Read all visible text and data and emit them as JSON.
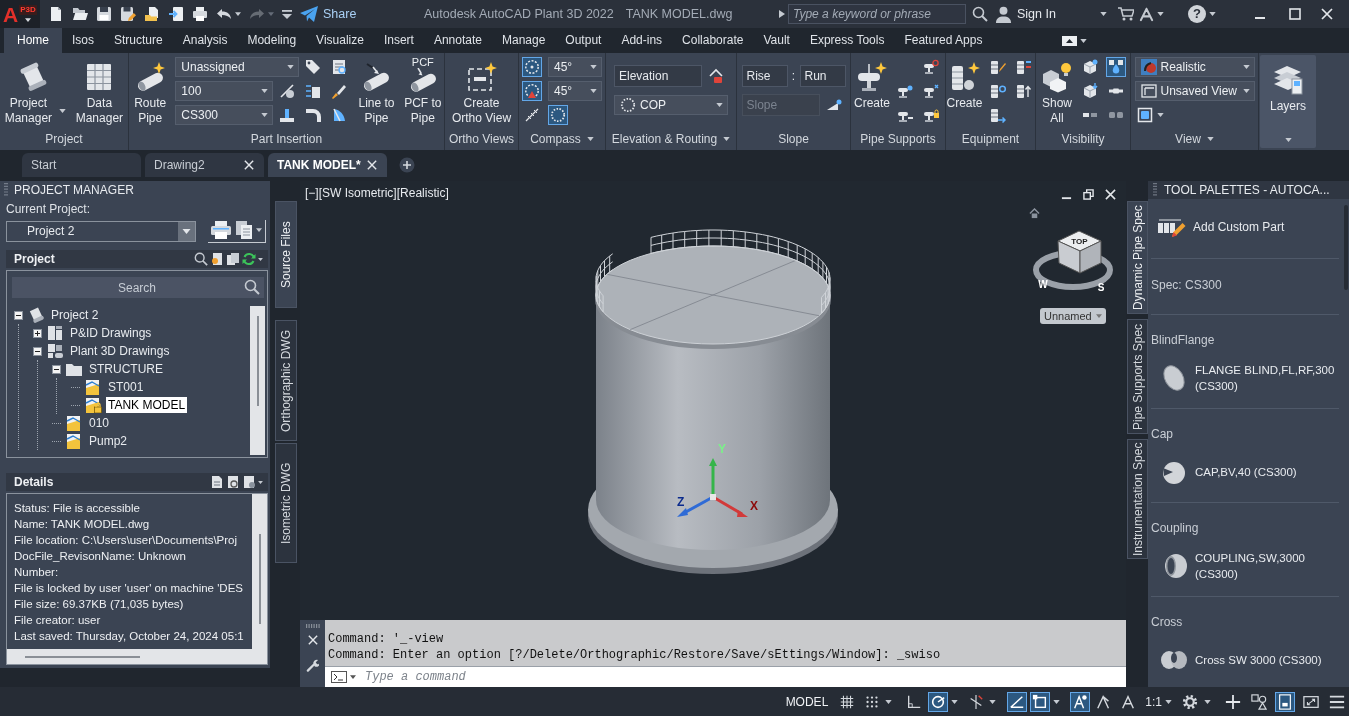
{
  "app_button": {
    "letter": "A",
    "product": "P3D"
  },
  "quick_access": {
    "tools": [
      {
        "disabled": false
      },
      {
        "disabled": false
      },
      {
        "disabled": false
      },
      {
        "disabled": false
      },
      {
        "disabled": false
      },
      {
        "disabled": false
      },
      {
        "disabled": false
      },
      {
        "disabled": false
      },
      {
        "disabled": true
      }
    ],
    "share": "Share"
  },
  "window": {
    "title": "Autodesk AutoCAD Plant 3D 2022",
    "document": "TANK MODEL.dwg"
  },
  "search": {
    "placeholder": "Type a keyword or phrase"
  },
  "account": {
    "label": "Sign In"
  },
  "help": {
    "label": "?"
  },
  "ribbon": {
    "tabs": [
      {
        "label": "Home",
        "selected": true
      },
      {
        "label": "Isos",
        "selected": false
      },
      {
        "label": "Structure",
        "selected": false
      },
      {
        "label": "Analysis",
        "selected": false
      },
      {
        "label": "Modeling",
        "selected": false
      },
      {
        "label": "Visualize",
        "selected": false
      },
      {
        "label": "Insert",
        "selected": false
      },
      {
        "label": "Annotate",
        "selected": false
      },
      {
        "label": "Manage",
        "selected": false
      },
      {
        "label": "Output",
        "selected": false
      },
      {
        "label": "Add-ins",
        "selected": false
      },
      {
        "label": "Collaborate",
        "selected": false
      },
      {
        "label": "Vault",
        "selected": false
      },
      {
        "label": "Express Tools",
        "selected": false
      },
      {
        "label": "Featured Apps",
        "selected": false
      }
    ],
    "panels": [
      {
        "kind": "panel",
        "title": "Project",
        "menu": false,
        "groups": [
          {
            "kind": "large",
            "label": "Project Manager",
            "menu": true
          },
          {
            "kind": "large",
            "label": "Data Manager",
            "menu": false
          }
        ]
      },
      {
        "kind": "panel",
        "title": "Part Insertion",
        "menu": false,
        "groups": [
          {
            "kind": "large",
            "label": "Route Pipe",
            "menu": false
          },
          {
            "kind": "grid",
            "items": [
              {
                "kind": "combo",
                "value": "Unassigned"
              },
              {
                "kind": "tool",
                "on": false
              },
              {
                "kind": "tool",
                "on": false
              },
              {
                "kind": "combo",
                "value": "100"
              },
              {
                "kind": "tool",
                "on": false
              },
              {
                "kind": "tool",
                "on": false
              },
              {
                "kind": "tool",
                "on": false
              },
              {
                "kind": "combo",
                "value": "CS300"
              },
              {
                "kind": "tool",
                "on": false
              },
              {
                "kind": "tool",
                "on": false
              },
              {
                "kind": "tool",
                "on": false
              }
            ]
          },
          {
            "kind": "large",
            "label": "Line to Pipe",
            "menu": false
          },
          {
            "kind": "large",
            "label": "PCF to Pipe",
            "icon_text": "PCF",
            "menu": false
          }
        ]
      },
      {
        "kind": "panel",
        "title": "Ortho Views",
        "menu": false,
        "groups": [
          {
            "kind": "large",
            "label": "Create Ortho View",
            "menu": false
          }
        ]
      },
      {
        "kind": "panel",
        "title": "Compass",
        "menu": true,
        "groups": [
          {
            "kind": "grid",
            "items": [
              {
                "kind": "tool",
                "on": true
              },
              {
                "kind": "combo",
                "value": "45°"
              },
              {
                "kind": "tool",
                "on": true
              },
              {
                "kind": "combo",
                "value": "45°"
              },
              {
                "kind": "tool",
                "on": false
              },
              {
                "kind": "tool",
                "on": true
              }
            ]
          }
        ]
      },
      {
        "kind": "panel",
        "title": "Elevation & Routing",
        "menu": true,
        "groups": [
          {
            "kind": "grid",
            "items": [
              {
                "kind": "field",
                "placeholder": "Elevation",
                "disabled": false
              },
              {
                "kind": "tool",
                "on": false
              },
              {
                "kind": "combo",
                "value": "COP"
              }
            ]
          }
        ]
      },
      {
        "kind": "panel",
        "title": "Slope",
        "menu": false,
        "groups": [
          {
            "kind": "grid",
            "items": [
              {
                "kind": "field",
                "placeholder": "Rise",
                "disabled": false
              },
              {
                "kind": "text",
                "label": ":"
              },
              {
                "kind": "field",
                "placeholder": "Run",
                "disabled": false
              },
              {
                "kind": "field",
                "placeholder": "Slope",
                "disabled": true
              },
              {
                "kind": "tool",
                "on": false
              }
            ]
          }
        ]
      },
      {
        "kind": "panel",
        "title": "Pipe Supports",
        "menu": false,
        "groups": [
          {
            "kind": "large",
            "label": "Create",
            "menu": false
          },
          {
            "kind": "grid",
            "items": [
              {
                "kind": "tool",
                "on": false
              },
              {
                "kind": "tool",
                "on": false
              },
              {
                "kind": "tool",
                "on": false
              },
              {
                "kind": "tool",
                "on": false
              },
              {
                "kind": "tool",
                "on": false
              }
            ]
          }
        ]
      },
      {
        "kind": "panel",
        "title": "Equipment",
        "menu": false,
        "groups": [
          {
            "kind": "large",
            "label": "Create",
            "menu": false
          },
          {
            "kind": "grid",
            "items": [
              {
                "kind": "tool",
                "on": false
              },
              {
                "kind": "tool",
                "on": false
              },
              {
                "kind": "tool",
                "on": false
              },
              {
                "kind": "tool",
                "on": false
              },
              {
                "kind": "tool",
                "on": false
              }
            ]
          }
        ]
      },
      {
        "kind": "panel",
        "title": "Visibility",
        "menu": false,
        "groups": [
          {
            "kind": "large",
            "label": "Show All",
            "menu": false
          },
          {
            "kind": "grid",
            "items": [
              {
                "kind": "tool",
                "on": false
              },
              {
                "kind": "tool",
                "on": true
              },
              {
                "kind": "tool",
                "on": false
              },
              {
                "kind": "tool",
                "on": false
              },
              {
                "kind": "tool",
                "on": false
              },
              {
                "kind": "tool",
                "on": false
              }
            ]
          }
        ]
      },
      {
        "kind": "panel",
        "title": "View",
        "menu": true,
        "groups": [
          {
            "kind": "grid",
            "items": [
              {
                "kind": "combo",
                "value": "Realistic"
              },
              {
                "kind": "combo",
                "value": "Unsaved View"
              },
              {
                "kind": "tool",
                "on": false
              }
            ]
          }
        ]
      },
      {
        "kind": "collapsed",
        "label": "Layers"
      }
    ]
  },
  "document_tabs": [
    {
      "label": "Start",
      "selected": false,
      "closable": false
    },
    {
      "label": "Drawing2",
      "selected": false,
      "closable": true
    },
    {
      "label": "TANK MODEL*",
      "selected": true,
      "closable": true
    }
  ],
  "project_manager": {
    "title": "PROJECT MANAGER",
    "current_project_label": "Current Project:",
    "current_project": "Project 2",
    "project_heading": "Project",
    "search_placeholder": "Search",
    "tree": [
      {
        "label": "Project 2",
        "kind": "project",
        "expanded": true,
        "selected": false,
        "children": [
          {
            "label": "P&ID Drawings",
            "kind": "pidfolder",
            "expanded": false,
            "selected": false
          },
          {
            "label": "Plant 3D Drawings",
            "kind": "plantfolder",
            "expanded": true,
            "selected": false,
            "children": [
              {
                "label": "STRUCTURE",
                "kind": "folder",
                "expanded": true,
                "selected": false,
                "children": [
                  {
                    "label": "ST001",
                    "kind": "drawing",
                    "locked": false,
                    "selected": false
                  },
                  {
                    "label": "TANK MODEL",
                    "kind": "drawing",
                    "locked": true,
                    "selected": true
                  }
                ]
              },
              {
                "label": "010",
                "kind": "drawing",
                "locked": false,
                "selected": false
              },
              {
                "label": "Pump2",
                "kind": "drawing",
                "locked": false,
                "selected": false
              }
            ]
          }
        ]
      }
    ],
    "details_heading": "Details",
    "details": [
      "Status: File is accessible",
      "Name: TANK MODEL.dwg",
      "File location: C:\\Users\\user\\Documents\\Proj",
      "DocFile_RevisonName: Unknown",
      "Number:",
      "File is locked by user 'user' on machine 'DES",
      "File size: 69.37KB (71,035 bytes)",
      "File creator: user",
      "Last saved: Thursday, October 24, 2024 05:1"
    ],
    "side_tabs": [
      {
        "label": "Source Files",
        "selected": true
      },
      {
        "label": "Orthographic DWG",
        "selected": false
      },
      {
        "label": "Isometric DWG",
        "selected": false
      }
    ]
  },
  "viewport": {
    "labels": [
      "[−]",
      "[SW Isometric]",
      "[Realistic]"
    ],
    "view_cube": {
      "face": "TOP",
      "compass": [
        "W",
        "S"
      ]
    },
    "named_view": "Unnamed",
    "ucs": {
      "x": "X",
      "y": "Y",
      "z": "Z"
    }
  },
  "command_line": {
    "history": [
      "Command: '_-view",
      "Command: Enter an option [?/Delete/Orthographic/Restore/Save/sEttings/Window]: _swiso"
    ],
    "placeholder": "Type a command"
  },
  "tool_palettes": {
    "title": "TOOL PALETTES - AUTOCA...",
    "tabs": [
      {
        "label": "Dynamic Pipe Spec",
        "selected": true
      },
      {
        "label": "Pipe Supports Spec",
        "selected": false
      },
      {
        "label": "Instrumentation Spec",
        "selected": false
      }
    ],
    "add_part": "Add Custom Part",
    "spec": "Spec: CS300",
    "groups": [
      {
        "heading": "BlindFlange",
        "part": "FLANGE BLIND,FL,RF,300 (CS300)"
      },
      {
        "heading": "Cap",
        "part": "CAP,BV,40 (CS300)"
      },
      {
        "heading": "Coupling",
        "part": "COUPLING,SW,3000 (CS300)"
      },
      {
        "heading": "Cross",
        "part": "Cross SW 3000 (CS300)"
      }
    ]
  },
  "status_bar": {
    "model": "MODEL",
    "tools": [
      {
        "on": false
      },
      {
        "on": false
      },
      {
        "on": false
      },
      {
        "on": true
      },
      {
        "on": false
      },
      {
        "on": true
      },
      {
        "on": true
      },
      {
        "on": true
      },
      {
        "on": false
      },
      {
        "on": false
      },
      {
        "on": false
      },
      {
        "on": false
      },
      {
        "on": false
      },
      {
        "on": true
      },
      {
        "on": false
      },
      {
        "on": false
      }
    ],
    "scale": "1:1"
  }
}
